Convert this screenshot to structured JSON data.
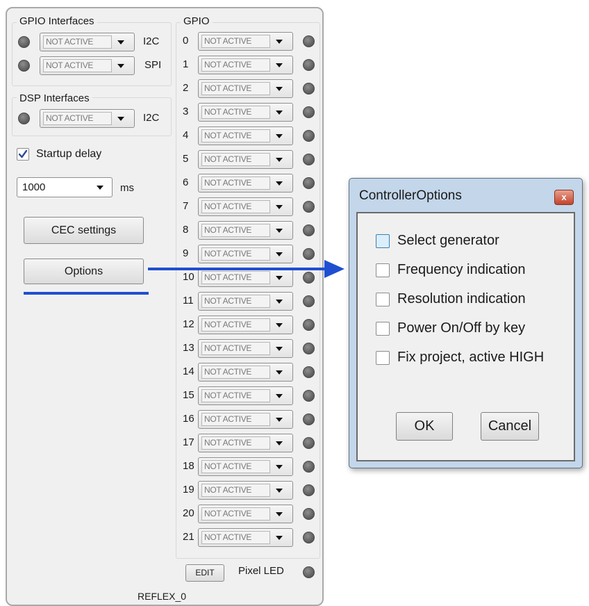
{
  "colors": {
    "accent_arrow": "#1f4fd1",
    "led": "#6a6a6a",
    "dialog_frame": "#c3d6ea",
    "close_button": "#c4442c"
  },
  "gpio_interfaces": {
    "title": "GPIO Interfaces",
    "rows": [
      {
        "value": "NOT ACTIVE",
        "label": "I2C"
      },
      {
        "value": "NOT ACTIVE",
        "label": "SPI"
      }
    ]
  },
  "dsp_interfaces": {
    "title": "DSP Interfaces",
    "rows": [
      {
        "value": "NOT ACTIVE",
        "label": "I2C"
      }
    ]
  },
  "startup_delay": {
    "label": "Startup delay",
    "checked": true,
    "value": "1000",
    "unit": "ms"
  },
  "buttons": {
    "cec_settings": "CEC settings",
    "options": "Options",
    "edit": "EDIT"
  },
  "gpio": {
    "title": "GPIO",
    "pins": [
      {
        "num": "0",
        "value": "NOT ACTIVE"
      },
      {
        "num": "1",
        "value": "NOT ACTIVE"
      },
      {
        "num": "2",
        "value": "NOT ACTIVE"
      },
      {
        "num": "3",
        "value": "NOT ACTIVE"
      },
      {
        "num": "4",
        "value": "NOT ACTIVE"
      },
      {
        "num": "5",
        "value": "NOT ACTIVE"
      },
      {
        "num": "6",
        "value": "NOT ACTIVE"
      },
      {
        "num": "7",
        "value": "NOT ACTIVE"
      },
      {
        "num": "8",
        "value": "NOT ACTIVE"
      },
      {
        "num": "9",
        "value": "NOT ACTIVE"
      },
      {
        "num": "10",
        "value": "NOT ACTIVE"
      },
      {
        "num": "11",
        "value": "NOT ACTIVE"
      },
      {
        "num": "12",
        "value": "NOT ACTIVE"
      },
      {
        "num": "13",
        "value": "NOT ACTIVE"
      },
      {
        "num": "14",
        "value": "NOT ACTIVE"
      },
      {
        "num": "15",
        "value": "NOT ACTIVE"
      },
      {
        "num": "16",
        "value": "NOT ACTIVE"
      },
      {
        "num": "17",
        "value": "NOT ACTIVE"
      },
      {
        "num": "18",
        "value": "NOT ACTIVE"
      },
      {
        "num": "19",
        "value": "NOT ACTIVE"
      },
      {
        "num": "20",
        "value": "NOT ACTIVE"
      },
      {
        "num": "21",
        "value": "NOT ACTIVE"
      }
    ]
  },
  "pixel_led": {
    "label": "Pixel LED"
  },
  "device_name": "REFLEX_0",
  "dialog": {
    "title": "ControllerOptions",
    "close_glyph": "x",
    "options": [
      {
        "label": "Select generator",
        "checked": false,
        "focused": true
      },
      {
        "label": "Frequency indication",
        "checked": false
      },
      {
        "label": "Resolution indication",
        "checked": false
      },
      {
        "label": "Power On/Off by key",
        "checked": false
      },
      {
        "label": "Fix project, active HIGH",
        "checked": false
      }
    ],
    "ok": "OK",
    "cancel": "Cancel"
  }
}
